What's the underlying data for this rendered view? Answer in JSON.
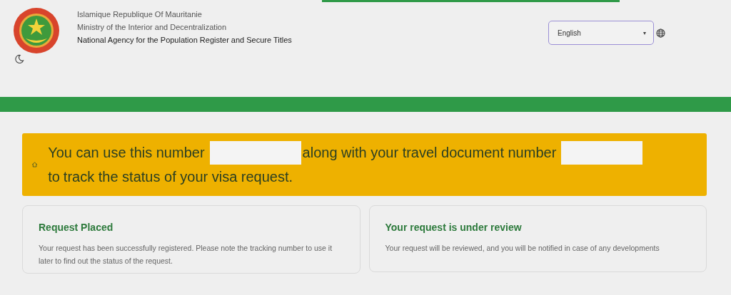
{
  "header": {
    "lines": [
      {
        "text": "Islamique Republique Of Mauritanie",
        "kind": "muted"
      },
      {
        "text": "Ministry of the Interior and Decentralization",
        "kind": "muted"
      },
      {
        "text": "National Agency for the Population Register and Secure Titles",
        "kind": "strong"
      }
    ],
    "language": {
      "value": "English",
      "caret": "▾"
    }
  },
  "notice": {
    "parts": [
      {
        "kind": "text",
        "text": "You can use this number"
      },
      {
        "kind": "redacted"
      },
      {
        "kind": "text",
        "text": "along with your travel document number"
      },
      {
        "kind": "redacted"
      },
      {
        "kind": "text",
        "text": "to"
      },
      {
        "kind": "text",
        "text": "track the status of your visa request."
      }
    ]
  },
  "cards": [
    {
      "title": "Request Placed",
      "body": "Your request has been successfully registered. Please note the tracking number to use it later to find out the status of the request."
    },
    {
      "title": "Your request is under review",
      "body": "Your request will be reviewed, and you will be notified in case of any developments"
    }
  ]
}
